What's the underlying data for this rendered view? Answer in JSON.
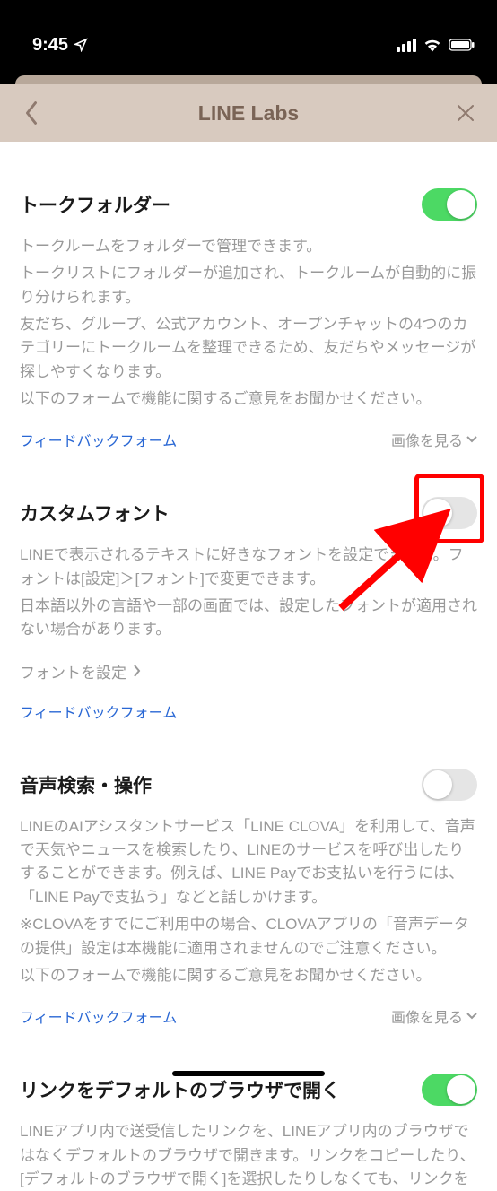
{
  "status": {
    "time": "9:45"
  },
  "header": {
    "title": "LINE Labs"
  },
  "sections": [
    {
      "title": "トークフォルダー",
      "toggle": true,
      "desc_lines": [
        "トークルームをフォルダーで管理できます。",
        "トークリストにフォルダーが追加され、トークルームが自動的に振り分けられます。",
        "友だち、グループ、公式アカウント、オープンチャットの4つのカテゴリーにトークルームを整理できるため、友だちやメッセージが探しやすくなります。",
        "以下のフォームで機能に関するご意見をお聞かせください。"
      ],
      "feedback": "フィードバックフォーム",
      "view_image": "画像を見る"
    },
    {
      "title": "カスタムフォント",
      "toggle": false,
      "desc_lines": [
        "LINEで表示されるテキストに好きなフォントを設定できます。フォントは[設定]＞[フォント]で変更できます。",
        "",
        "日本語以外の言語や一部の画面では、設定したフォントが適用されない場合があります。"
      ],
      "sub_link": "フォントを設定",
      "feedback": "フィードバックフォーム"
    },
    {
      "title": "音声検索・操作",
      "toggle": false,
      "desc_lines": [
        "LINEのAIアシスタントサービス「LINE CLOVA」を利用して、音声で天気やニュースを検索したり、LINEのサービスを呼び出したりすることができます。例えば、LINE Payでお支払いを行うには、「LINE Payで支払う」などと話しかけます。",
        "※CLOVAをすでにご利用中の場合、CLOVAアプリの「音声データの提供」設定は本機能に適用されませんのでご注意ください。",
        "以下のフォームで機能に関するご意見をお聞かせください。"
      ],
      "feedback": "フィードバックフォーム",
      "view_image": "画像を見る"
    },
    {
      "title": "リンクをデフォルトのブラウザで開く",
      "toggle": true,
      "desc_lines": [
        "LINEアプリ内で送受信したリンクを、LINEアプリ内のブラウザではなくデフォルトのブラウザで開きます。リンクをコピーしたり、[デフォルトのブラウザで開く]を選択したりしなくても、リンクを"
      ]
    }
  ]
}
